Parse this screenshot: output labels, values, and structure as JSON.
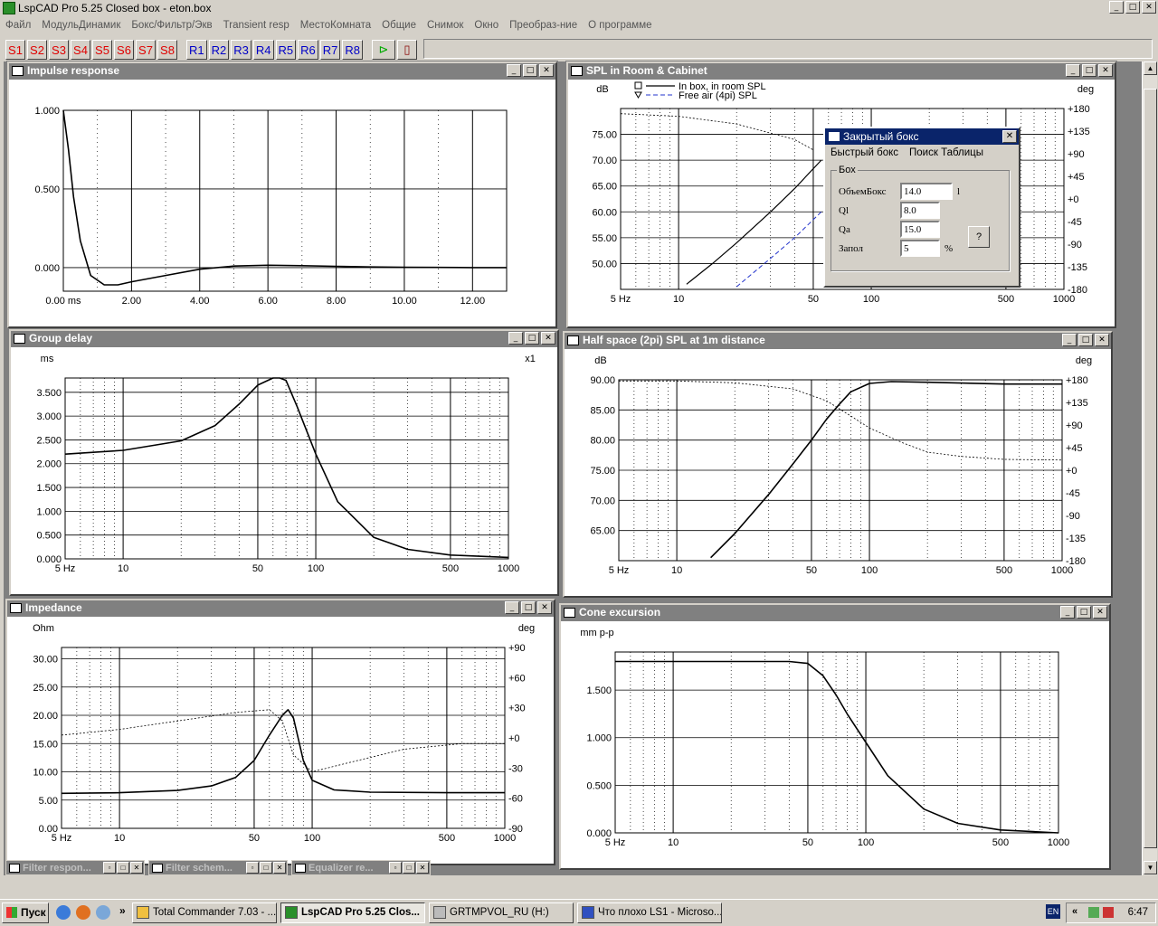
{
  "title": "LspCAD Pro 5.25 Closed box - eton.box",
  "menu": [
    "Файл",
    "МодульДинамик",
    "Бокс/Фильтр/Экв",
    "Transient resp",
    "МестоКомната",
    "Общие",
    "Снимок",
    "Окно",
    "Преобраз-ние",
    "О программе"
  ],
  "toolbar": {
    "s_buttons": [
      "S1",
      "S2",
      "S3",
      "S4",
      "S5",
      "S6",
      "S7",
      "S8"
    ],
    "r_buttons": [
      "R1",
      "R2",
      "R3",
      "R4",
      "R5",
      "R6",
      "R7",
      "R8"
    ]
  },
  "windows": {
    "impulse": {
      "title": "Impulse response"
    },
    "splroom": {
      "title": "SPL in Room & Cabinet",
      "legend1": "In box, in room SPL",
      "legend2": "Free air (4pi) SPL"
    },
    "group": {
      "title": "Group delay"
    },
    "halfspace": {
      "title": "Half space (2pi) SPL at 1m distance"
    },
    "impedance": {
      "title": "Impedance"
    },
    "cone": {
      "title": "Cone excursion"
    }
  },
  "minimized": [
    "Filter respon...",
    "Filter schem...",
    "Equalizer re..."
  ],
  "dialog": {
    "title": "Закрытый бокс",
    "menu": [
      "Быстрый бокс",
      "Поиск Таблицы"
    ],
    "group": "Бох",
    "fields": [
      {
        "label": "ОбъемБокс",
        "value": "14.0",
        "unit": "l"
      },
      {
        "label": "Ql",
        "value": "8.0",
        "unit": ""
      },
      {
        "label": "Qa",
        "value": "15.0",
        "unit": ""
      },
      {
        "label": "Запол",
        "value": "5",
        "unit": "%"
      }
    ],
    "help": "?"
  },
  "taskbar": {
    "start": "Пуск",
    "tasks": [
      "Total Commander 7.03 - ...",
      "LspCAD Pro 5.25 Clos...",
      "GRTMPVOL_RU (H:)",
      "Что плохо LS1 - Microso..."
    ],
    "lang": "EN",
    "clock": "6:47"
  },
  "chart_data": [
    {
      "type": "line",
      "title": "Impulse response",
      "xlabel": "",
      "ylabel": "",
      "xticks": [
        "0.00 ms",
        "2.00",
        "4.00",
        "6.00",
        "8.00",
        "10.00",
        "12.00"
      ],
      "yticks": [
        "1.000",
        "0.500",
        "0.000"
      ],
      "xlim": [
        0,
        13
      ],
      "ylim": [
        -0.15,
        1.0
      ],
      "series": [
        {
          "x": [
            0,
            0.15,
            0.3,
            0.5,
            0.8,
            1.2,
            1.6,
            2.0,
            3.0,
            4.0,
            5.0,
            6.0,
            7.0,
            8.0,
            9.0,
            10.0,
            11.0,
            12.0,
            13.0
          ],
          "y": [
            1.0,
            0.75,
            0.45,
            0.17,
            -0.05,
            -0.11,
            -0.11,
            -0.09,
            -0.05,
            -0.01,
            0.01,
            0.015,
            0.012,
            0.008,
            0.004,
            0.002,
            0.001,
            0.0,
            0.0
          ]
        }
      ]
    },
    {
      "type": "line",
      "title": "SPL in Room & Cabinet",
      "ylabel": "dB",
      "y2label": "deg",
      "xscale": "log",
      "xlim": [
        5,
        1000
      ],
      "ylim": [
        45,
        80
      ],
      "xticks": [
        "5 Hz",
        "10",
        "50",
        "100",
        "500",
        "1000"
      ],
      "yticks": [
        "75.00",
        "70.00",
        "65.00",
        "60.00",
        "55.00",
        "50.00"
      ],
      "y2ticks": [
        "+180",
        "+135",
        "+90",
        "+45",
        "+0",
        "-45",
        "-90",
        "-135",
        "-180"
      ],
      "series": [
        {
          "name": "In box, in room SPL",
          "x": [
            11,
            15,
            20,
            30,
            40,
            55
          ],
          "y": [
            46,
            50,
            54,
            60,
            64.5,
            70
          ]
        },
        {
          "name": "Free air (4pi) SPL",
          "x": [
            20,
            30,
            40,
            55
          ],
          "y": [
            45.5,
            51,
            55,
            60
          ]
        },
        {
          "name": "phase",
          "x": [
            5,
            10,
            20,
            40,
            50
          ],
          "y": [
            79,
            78.5,
            77,
            74,
            72
          ]
        }
      ]
    },
    {
      "type": "line",
      "title": "Group delay",
      "ylabel": "ms",
      "y2label": "x1",
      "xscale": "log",
      "xlim": [
        5,
        1000
      ],
      "ylim": [
        0,
        3.8
      ],
      "xticks": [
        "5 Hz",
        "10",
        "50",
        "100",
        "500",
        "1000"
      ],
      "yticks": [
        "3.500",
        "3.000",
        "2.500",
        "2.000",
        "1.500",
        "1.000",
        "0.500",
        "0.000"
      ],
      "series": [
        {
          "x": [
            5,
            10,
            20,
            30,
            40,
            50,
            60,
            65,
            70,
            80,
            100,
            130,
            200,
            300,
            500,
            1000
          ],
          "y": [
            2.2,
            2.28,
            2.48,
            2.8,
            3.25,
            3.65,
            3.85,
            3.85,
            3.75,
            3.2,
            2.2,
            1.2,
            0.45,
            0.2,
            0.08,
            0.03
          ]
        }
      ]
    },
    {
      "type": "line",
      "title": "Half space (2pi) SPL at 1m distance",
      "ylabel": "dB",
      "y2label": "deg",
      "xscale": "log",
      "xlim": [
        5,
        1000
      ],
      "ylim": [
        60,
        90
      ],
      "xticks": [
        "5 Hz",
        "10",
        "50",
        "100",
        "500",
        "1000"
      ],
      "yticks": [
        "90.00",
        "85.00",
        "80.00",
        "75.00",
        "70.00",
        "65.00"
      ],
      "y2ticks": [
        "+180",
        "+135",
        "+90",
        "+45",
        "+0",
        "-45",
        "-90",
        "-135",
        "-180"
      ],
      "series": [
        {
          "x": [
            15,
            20,
            30,
            40,
            50,
            60,
            70,
            80,
            100,
            130,
            200,
            500,
            1000
          ],
          "y": [
            60.5,
            64.5,
            71,
            76,
            80,
            83.5,
            86,
            88,
            89.4,
            89.7,
            89.6,
            89.3,
            89.3
          ]
        },
        {
          "x": [
            5,
            10,
            20,
            40,
            60,
            80,
            100,
            150,
            200,
            300,
            500,
            1000
          ],
          "y": [
            89.8,
            89.8,
            89.5,
            88.5,
            86.5,
            84,
            82,
            79.5,
            78,
            77.3,
            76.8,
            76.7
          ]
        }
      ]
    },
    {
      "type": "line",
      "title": "Impedance",
      "ylabel": "Ohm",
      "y2label": "deg",
      "xscale": "log",
      "xlim": [
        5,
        1000
      ],
      "ylim": [
        0,
        32
      ],
      "xticks": [
        "5 Hz",
        "10",
        "50",
        "100",
        "500",
        "1000"
      ],
      "yticks": [
        "30.00",
        "25.00",
        "20.00",
        "15.00",
        "10.00",
        "5.00",
        "0.00"
      ],
      "y2ticks": [
        "+90",
        "+60",
        "+30",
        "+0",
        "-30",
        "-60",
        "-90"
      ],
      "series": [
        {
          "x": [
            5,
            10,
            20,
            30,
            40,
            50,
            60,
            70,
            75,
            80,
            90,
            100,
            130,
            200,
            500,
            1000
          ],
          "y": [
            6.2,
            6.3,
            6.7,
            7.5,
            9,
            12,
            16.5,
            20,
            21,
            19.5,
            12,
            8.5,
            6.8,
            6.4,
            6.3,
            6.3
          ]
        },
        {
          "x": [
            5,
            10,
            20,
            40,
            60,
            70,
            80,
            100,
            150,
            300,
            600,
            1000
          ],
          "y": [
            16.5,
            17.5,
            19,
            20.5,
            21,
            19,
            13,
            10,
            11.5,
            14,
            15,
            15
          ]
        }
      ]
    },
    {
      "type": "line",
      "title": "Cone excursion",
      "ylabel": "mm p-p",
      "xscale": "log",
      "xlim": [
        5,
        1000
      ],
      "ylim": [
        0,
        1.9
      ],
      "xticks": [
        "5 Hz",
        "10",
        "50",
        "100",
        "500",
        "1000"
      ],
      "yticks": [
        "1.500",
        "1.000",
        "0.500",
        "0.000"
      ],
      "series": [
        {
          "x": [
            5,
            10,
            20,
            40,
            50,
            60,
            70,
            80,
            100,
            130,
            200,
            300,
            500,
            1000
          ],
          "y": [
            1.8,
            1.8,
            1.8,
            1.8,
            1.78,
            1.65,
            1.45,
            1.25,
            0.95,
            0.6,
            0.25,
            0.1,
            0.03,
            0.0
          ]
        }
      ]
    }
  ]
}
